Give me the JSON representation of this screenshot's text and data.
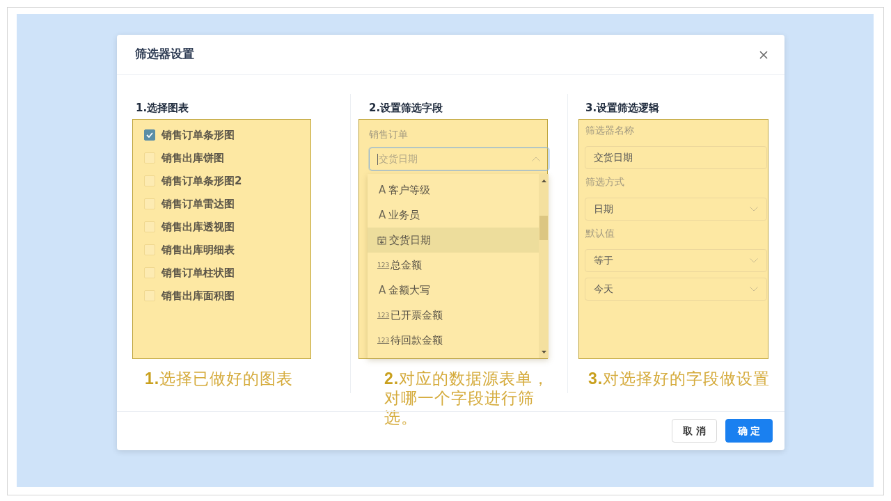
{
  "dialog": {
    "title": "筛选器设置"
  },
  "step1": {
    "title": "1.选择图表",
    "charts": [
      {
        "label": "销售订单条形图",
        "checked": true
      },
      {
        "label": "销售出库饼图",
        "checked": false
      },
      {
        "label": "销售订单条形图2",
        "checked": false
      },
      {
        "label": "销售订单雷达图",
        "checked": false
      },
      {
        "label": "销售出库透视图",
        "checked": false
      },
      {
        "label": "销售出库明细表",
        "checked": false
      },
      {
        "label": "销售订单柱状图",
        "checked": false
      },
      {
        "label": "销售出库面积图",
        "checked": false
      }
    ],
    "caption": "**1.**选择已做好的图表"
  },
  "step2": {
    "title": "2.设置筛选字段",
    "source": "销售订单",
    "field_select": {
      "placeholder": "交货日期",
      "focused": true,
      "expanded": true
    },
    "options": [
      {
        "kind": "text",
        "icon_text": "A",
        "label": "客户等级",
        "selected": false
      },
      {
        "kind": "text",
        "icon_text": "A",
        "label": "业务员",
        "selected": false
      },
      {
        "kind": "date",
        "label": "交货日期",
        "selected": true
      },
      {
        "kind": "number",
        "icon_text": "123",
        "label": "总金额",
        "selected": false
      },
      {
        "kind": "text",
        "icon_text": "A",
        "label": "金额大写",
        "selected": false
      },
      {
        "kind": "number",
        "icon_text": "123",
        "label": "已开票金额",
        "selected": false
      },
      {
        "kind": "number",
        "icon_text": "123",
        "label": "待回款金额",
        "selected": false
      }
    ],
    "caption": "**2.**对应的数据源表单，对哪一个字段进行筛选。"
  },
  "step3": {
    "title": "3.设置筛选逻辑",
    "fields": [
      {
        "kind": "input",
        "label": "筛选器名称",
        "value": "交货日期"
      },
      {
        "kind": "select",
        "label": "筛选方式",
        "value": "日期"
      },
      {
        "kind": "select",
        "label": "默认值",
        "value": "等于"
      },
      {
        "kind": "select",
        "value": "今天"
      }
    ],
    "caption": "**3.**对选择好的字段做设置"
  },
  "buttons": [
    {
      "label": "取 消",
      "kind": "default"
    },
    {
      "label": "确 定",
      "kind": "primary"
    }
  ]
}
